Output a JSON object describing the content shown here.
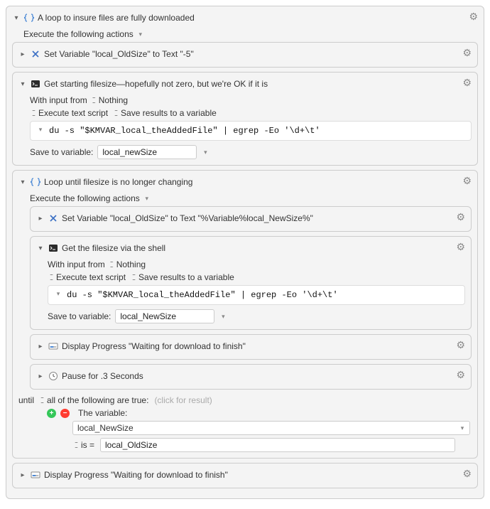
{
  "outer": {
    "title": "A loop to insure files are fully downloaded",
    "execute_label": "Execute the following actions",
    "set_var_1": "Set Variable \"local_OldSize\" to Text \"-5\"",
    "shell1": {
      "title": "Get starting filesize—hopefully not zero, but we're OK if it is",
      "with_input_label": "With input from",
      "with_input_value": "Nothing",
      "exec_label": "Execute text script",
      "save_opt": "Save results to a variable",
      "code": "du -s \"$KMVAR_local_theAddedFile\" | egrep -Eo '\\d+\\t'",
      "save_to_label": "Save to variable:",
      "save_to_value": "local_newSize"
    },
    "loop": {
      "title": "Loop until filesize is no longer changing",
      "execute_label": "Execute the following actions",
      "set_var_2": "Set Variable \"local_OldSize\" to Text \"%Variable%local_NewSize%\"",
      "shell2": {
        "title": "Get the filesize via the shell",
        "with_input_label": "With input from",
        "with_input_value": "Nothing",
        "exec_label": "Execute text script",
        "save_opt": "Save results to a variable",
        "code": "du -s \"$KMVAR_local_theAddedFile\" | egrep -Eo '\\d+\\t'",
        "save_to_label": "Save to variable:",
        "save_to_value": "local_NewSize"
      },
      "display_progress": "Display Progress \"Waiting for download to finish\"",
      "pause": "Pause for .3 Seconds",
      "until_label": "until",
      "until_mode": "all of the following are true:",
      "click_hint": "(click for result)",
      "cond": {
        "variable_label": "The variable:",
        "variable_value": "local_NewSize",
        "op": "is =",
        "compare_value": "local_OldSize"
      }
    },
    "display_progress_outer": "Display Progress \"Waiting for download to finish\""
  }
}
